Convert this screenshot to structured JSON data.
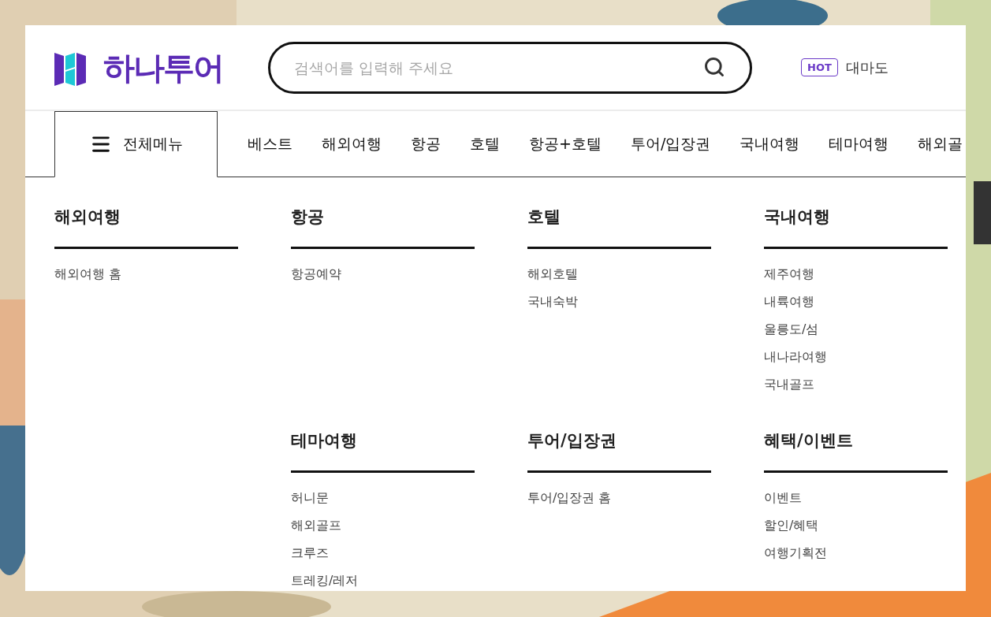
{
  "logo": {
    "text": "하나투어"
  },
  "search": {
    "placeholder": "검색어를 입력해 주세요"
  },
  "hot": {
    "badge": "HOT",
    "keyword": "대마도"
  },
  "all_menu": {
    "label": "전체메뉴",
    "selected": true
  },
  "nav": [
    {
      "label": "베스트"
    },
    {
      "label": "해외여행"
    },
    {
      "label": "항공"
    },
    {
      "label": "호텔"
    },
    {
      "label": "항공+호텔"
    },
    {
      "label": "투어/입장권"
    },
    {
      "label": "국내여행"
    },
    {
      "label": "테마여행"
    },
    {
      "label": "해외골"
    }
  ],
  "menu_rows": [
    [
      {
        "title": "해외여행",
        "items": [
          "해외여행 홈"
        ]
      },
      {
        "title": "항공",
        "items": [
          "항공예약"
        ]
      },
      {
        "title": "호텔",
        "items": [
          "해외호텔",
          "국내숙박"
        ]
      },
      {
        "title": "국내여행",
        "items": [
          "제주여행",
          "내륙여행",
          "울릉도/섬",
          "내나라여행",
          "국내골프"
        ]
      }
    ],
    [
      {
        "title": "테마여행",
        "items": [
          "허니문",
          "해외골프",
          "크루즈",
          "트레킹/레저"
        ]
      },
      {
        "title": "투어/입장권",
        "items": [
          "투어/입장권 홈"
        ]
      },
      {
        "title": "혜택/이벤트",
        "items": [
          "이벤트",
          "할인/혜택",
          "여행기획전"
        ]
      }
    ]
  ]
}
